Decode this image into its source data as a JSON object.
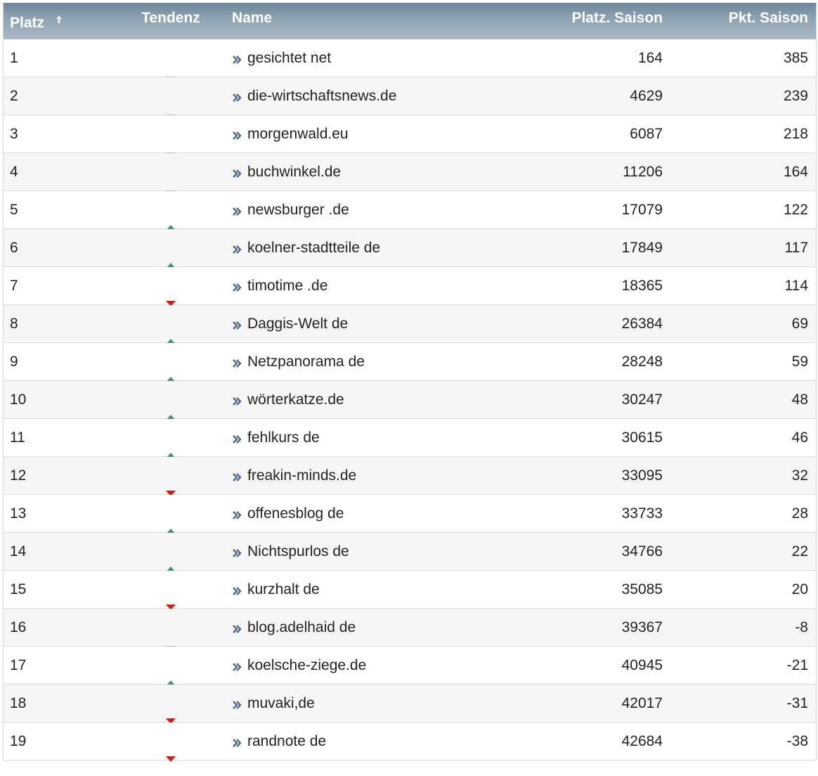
{
  "colors": {
    "trend_up": "#3a9a6a",
    "trend_down": "#c8231a",
    "trend_same": "#b8b8b8",
    "link_icon": "#4a6785",
    "header_text": "#ffffff"
  },
  "table": {
    "headers": {
      "platz": "Platz",
      "tendenz": "Tendenz",
      "name": "Name",
      "platz_saison": "Platz. Saison",
      "pkt_saison": "Pkt. Saison"
    },
    "sort_icon": "sort-up-arrow-icon",
    "rows": [
      {
        "platz": "1",
        "tendenz": "same",
        "name": "gesichtet net",
        "platz_saison": "164",
        "pkt_saison": "385"
      },
      {
        "platz": "2",
        "tendenz": "same",
        "name": "die-wirtschaftsnews.de",
        "platz_saison": "4629",
        "pkt_saison": "239"
      },
      {
        "platz": "3",
        "tendenz": "same",
        "name": "morgenwald.eu",
        "platz_saison": "6087",
        "pkt_saison": "218"
      },
      {
        "platz": "4",
        "tendenz": "same",
        "name": "buchwinkel.de",
        "platz_saison": "11206",
        "pkt_saison": "164"
      },
      {
        "platz": "5",
        "tendenz": "up",
        "name": "newsburger .de",
        "platz_saison": "17079",
        "pkt_saison": "122"
      },
      {
        "platz": "6",
        "tendenz": "up",
        "name": "koelner-stadtteile de",
        "platz_saison": "17849",
        "pkt_saison": "117"
      },
      {
        "platz": "7",
        "tendenz": "down",
        "name": "timotime .de",
        "platz_saison": "18365",
        "pkt_saison": "114"
      },
      {
        "platz": "8",
        "tendenz": "up",
        "name": "Daggis-Welt de",
        "platz_saison": "26384",
        "pkt_saison": "69"
      },
      {
        "platz": "9",
        "tendenz": "up",
        "name": "Netzpanorama de",
        "platz_saison": "28248",
        "pkt_saison": "59"
      },
      {
        "platz": "10",
        "tendenz": "up",
        "name": "wörterkatze.de",
        "platz_saison": "30247",
        "pkt_saison": "48"
      },
      {
        "platz": "11",
        "tendenz": "up",
        "name": "fehlkurs de",
        "platz_saison": "30615",
        "pkt_saison": "46"
      },
      {
        "platz": "12",
        "tendenz": "down",
        "name": "freakin-minds.de",
        "platz_saison": "33095",
        "pkt_saison": "32"
      },
      {
        "platz": "13",
        "tendenz": "up",
        "name": "offenesblog de",
        "platz_saison": "33733",
        "pkt_saison": "28"
      },
      {
        "platz": "14",
        "tendenz": "up",
        "name": "Nichtspurlos de",
        "platz_saison": "34766",
        "pkt_saison": "22"
      },
      {
        "platz": "15",
        "tendenz": "down",
        "name": "kurzhalt de",
        "platz_saison": "35085",
        "pkt_saison": "20"
      },
      {
        "platz": "16",
        "tendenz": "same",
        "name": "blog.adelhaid de",
        "platz_saison": "39367",
        "pkt_saison": "-8"
      },
      {
        "platz": "17",
        "tendenz": "up",
        "name": "koelsche-ziege.de",
        "platz_saison": "40945",
        "pkt_saison": "-21"
      },
      {
        "platz": "18",
        "tendenz": "down",
        "name": "muvaki,de",
        "platz_saison": "42017",
        "pkt_saison": "-31"
      },
      {
        "platz": "19",
        "tendenz": "down",
        "name": "randnote de",
        "platz_saison": "42684",
        "pkt_saison": "-38"
      }
    ]
  }
}
